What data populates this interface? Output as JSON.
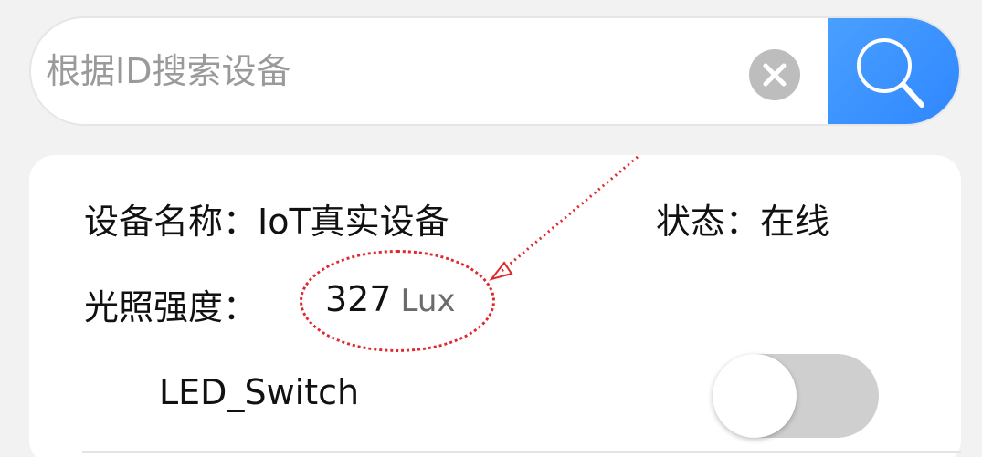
{
  "search": {
    "placeholder": "根据ID搜索设备",
    "value": ""
  },
  "icons": {
    "clear": "clear-icon",
    "search": "search-icon",
    "annotation_arrow": "arrow-icon"
  },
  "colors": {
    "search_button": "#2e86ff",
    "annotation": "#e0282e",
    "toggle_off": "#cfcfcf"
  },
  "device": {
    "name_label": "设备名称：",
    "name_value": "IoT真实设备",
    "status_label": "状态：",
    "status_value": "在线",
    "light_label": "光照强度：",
    "light_value": "327",
    "light_unit": "Lux",
    "led_label": "LED_Switch",
    "led_state": "off"
  }
}
